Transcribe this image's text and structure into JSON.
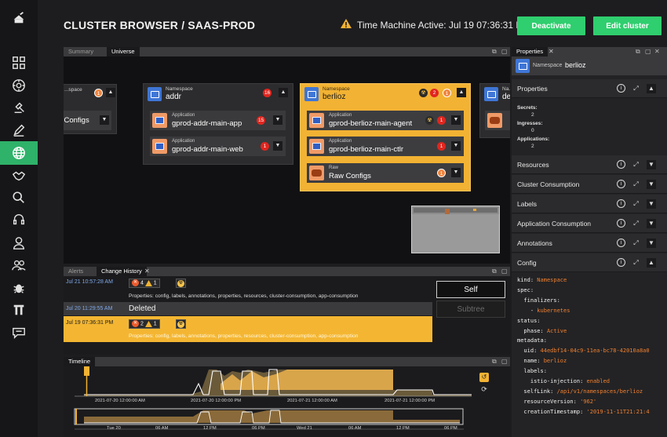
{
  "header": {
    "title": "CLUSTER BROWSER / SAAS-PROD",
    "time_machine": "Time Machine Active: Jul 19 07:36:31 PM",
    "deactivate": "Deactivate",
    "edit_cluster": "Edit cluster"
  },
  "nav": {
    "items": [
      "logo-icon",
      "grid-icon",
      "dashboard-icon",
      "gavel-icon",
      "pen-icon",
      "globe-icon",
      "handshake-icon",
      "search-icon",
      "headset-icon",
      "user-icon",
      "users-icon",
      "bug-icon",
      "tools-icon",
      "chat-icon"
    ],
    "active": "globe-icon"
  },
  "universe": {
    "tabs": [
      "Summary",
      "Universe"
    ],
    "active_tab": "Universe",
    "namespaces": [
      {
        "kind": "...space",
        "name": "",
        "badge": "1",
        "items": [
          {
            "kind": "",
            "name": "w Configs"
          }
        ]
      },
      {
        "kind": "Namespace",
        "name": "addr",
        "badge": "16",
        "items": [
          {
            "kind": "Application",
            "name": "gprod-addr-main-app",
            "badge": "15"
          },
          {
            "kind": "Application",
            "name": "gprod-addr-main-web",
            "badge": "1"
          }
        ]
      },
      {
        "kind": "Namespace",
        "name": "berlioz",
        "badge": "2",
        "badge2": "1",
        "items": [
          {
            "kind": "Application",
            "name": "gprod-berlioz-main-agent",
            "badge": "1"
          },
          {
            "kind": "Application",
            "name": "gprod-berlioz-main-ctlr",
            "badge": "1"
          },
          {
            "kind": "Raw",
            "name": "Raw Configs",
            "badge": "1"
          }
        ]
      },
      {
        "kind": "Na...",
        "name": "def..."
      }
    ]
  },
  "alerts": {
    "tabs": [
      "Alerts",
      "Change History"
    ],
    "active_tab": "Change History",
    "rows": [
      {
        "time": "Jul 21 10:57:28 AM",
        "errors": "4",
        "warnings": "1",
        "desc": "Properties: config, labels, annotations, properties, resources, cluster-consumption, app-consumption"
      },
      {
        "time": "Jul 20 11:29:55 AM",
        "label": "Deleted"
      },
      {
        "time": "Jul 19 07:36:31 PM",
        "errors": "2",
        "warnings": "1",
        "desc": "Properties: config, labels, annotations, properties, resources, cluster-consumption, app-consumption"
      }
    ],
    "self": "Self",
    "subtree": "Subtree"
  },
  "timeline": {
    "title": "Timeline",
    "top_ticks": [
      "2021-07-20 12:00:00 AM",
      "2021-07-20 12:00:00 PM",
      "2021-07-21 12:00:00 AM",
      "2021-07-21 12:00:00 PM"
    ],
    "bottom_ticks": [
      "Tue 20",
      "06 AM",
      "12 PM",
      "06 PM",
      "Wed 21",
      "06 AM",
      "12 PM",
      "06 PM"
    ]
  },
  "properties": {
    "tab": "Properties",
    "object_kind": "Namespace",
    "object_name": "berlioz",
    "sections": [
      "Properties",
      "Resources",
      "Cluster Consumption",
      "Labels",
      "Application Consumption",
      "Annotations",
      "Config"
    ],
    "kv": [
      {
        "k": "Secrets:",
        "v": "2"
      },
      {
        "k": "Ingresses:",
        "v": "0"
      },
      {
        "k": "Applications:",
        "v": "2"
      }
    ],
    "yaml": [
      {
        "k": "kind: ",
        "v": "Namespace"
      },
      {
        "k": "spec:",
        "v": ""
      },
      {
        "k": "  finalizers:",
        "v": ""
      },
      {
        "k": "    - ",
        "v": "kubernetes"
      },
      {
        "k": "status:",
        "v": ""
      },
      {
        "k": "  phase: ",
        "v": "Active"
      },
      {
        "k": "metadata:",
        "v": ""
      },
      {
        "k": "  uid: ",
        "v": "44edbf14-04c9-11ea-bc78-42010a8a0"
      },
      {
        "k": "  name: ",
        "v": "berlioz"
      },
      {
        "k": "  labels:",
        "v": ""
      },
      {
        "k": "    istio-injection: ",
        "v": "enabled"
      },
      {
        "k": "  selfLink: ",
        "v": "/api/v1/namespaces/berlioz"
      },
      {
        "k": "  resourceVersion: ",
        "v": "'962'"
      },
      {
        "k": "  creationTimestamp: ",
        "v": "'2019-11-11T21:21:4"
      }
    ]
  },
  "colors": {
    "accent_green": "#2fce6e",
    "selected_ns": "#f2b233",
    "error_red": "#e0261f",
    "warn_orange": "#f0843d"
  }
}
